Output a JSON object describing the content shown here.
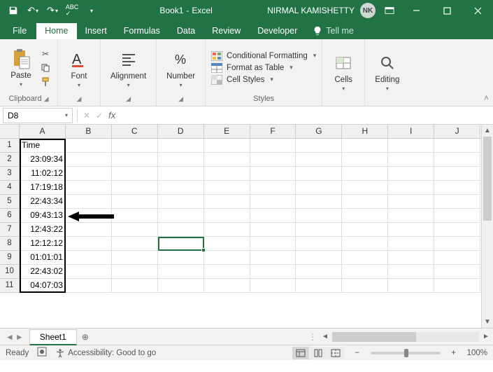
{
  "title": {
    "doc": "Book1",
    "app": "Excel",
    "separator": " - "
  },
  "user": {
    "name": "NIRMAL KAMISHETTY",
    "initials": "NK"
  },
  "tabs": {
    "file": "File",
    "home": "Home",
    "insert": "Insert",
    "formulas": "Formulas",
    "data": "Data",
    "review": "Review",
    "developer": "Developer",
    "tellme": "Tell me"
  },
  "ribbon": {
    "clipboard": {
      "label": "Clipboard",
      "paste": "Paste"
    },
    "font": {
      "label": "Font"
    },
    "alignment": {
      "label": "Alignment"
    },
    "number": {
      "label": "Number"
    },
    "styles": {
      "label": "Styles",
      "cond": "Conditional Formatting",
      "table": "Format as Table",
      "cell": "Cell Styles"
    },
    "cells": {
      "label": "Cells"
    },
    "editing": {
      "label": "Editing"
    }
  },
  "namebox": "D8",
  "columns": [
    "A",
    "B",
    "C",
    "D",
    "E",
    "F",
    "G",
    "H",
    "I",
    "J"
  ],
  "rows": [
    "1",
    "2",
    "3",
    "4",
    "5",
    "6",
    "7",
    "8",
    "9",
    "10",
    "11"
  ],
  "data": {
    "A1": "Time",
    "A2": "23:09:34",
    "A3": "11:02:12",
    "A4": "17:19:18",
    "A5": "22:43:34",
    "A6": "09:43:13",
    "A7": "12:43:22",
    "A8": "12:12:12",
    "A9": "01:01:01",
    "A10": "22:43:02",
    "A11": "04:07:03"
  },
  "sheet": {
    "name": "Sheet1"
  },
  "status": {
    "ready": "Ready",
    "access": "Accessibility: Good to go",
    "zoom": "100%"
  }
}
